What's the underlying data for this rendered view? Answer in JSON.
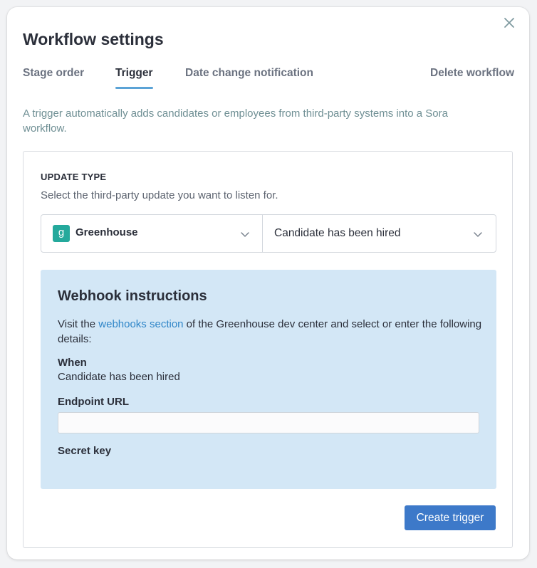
{
  "modal": {
    "title": "Workflow settings",
    "close_icon": "close-icon"
  },
  "tabs": {
    "stage_order": "Stage order",
    "trigger": "Trigger",
    "date_change": "Date change notification",
    "delete": "Delete workflow",
    "active": "Trigger"
  },
  "description": "A trigger automatically adds candidates or employees from third-party systems into a Sora workflow.",
  "update_type": {
    "label": "UPDATE TYPE",
    "subtitle": "Select the third-party update you want to listen for.",
    "integration": {
      "logo_letter": "g",
      "value": "Greenhouse"
    },
    "event": {
      "value": "Candidate has been hired"
    }
  },
  "webhook": {
    "title": "Webhook instructions",
    "text_before": "Visit the ",
    "link_text": "webhooks section",
    "text_after": " of the Greenhouse dev center and select or enter the following details:",
    "when_label": "When",
    "when_value": "Candidate has been hired",
    "endpoint_label": "Endpoint URL",
    "endpoint_value": "",
    "secret_label": "Secret key"
  },
  "actions": {
    "create_label": "Create trigger"
  },
  "colors": {
    "accent": "#3d79c9",
    "tab_underline": "#5ba3d6",
    "webhook_bg": "#d3e7f6",
    "link": "#2f86c8",
    "greenhouse": "#24a99c"
  }
}
